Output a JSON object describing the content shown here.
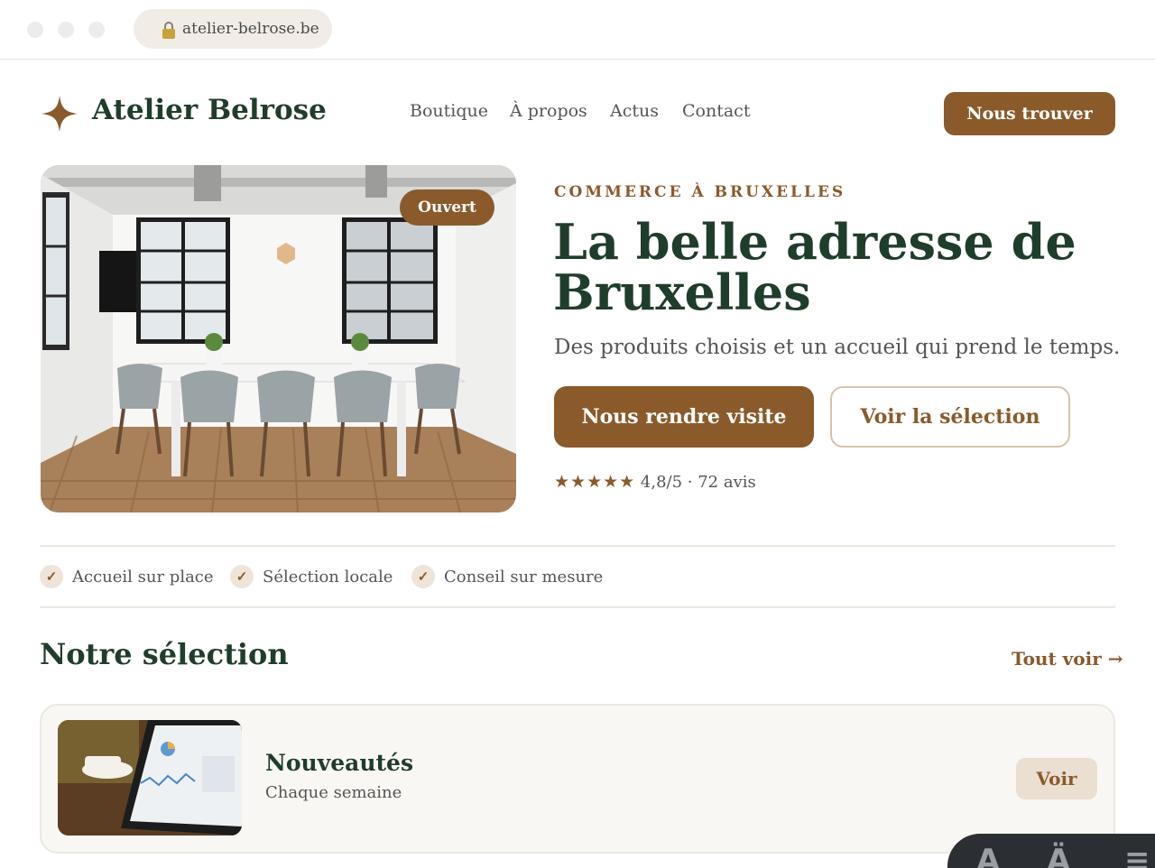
{
  "browser": {
    "url": "atelier-belrose.be"
  },
  "header": {
    "brand": "Atelier Belrose",
    "nav": [
      "Boutique",
      "À propos",
      "Actus",
      "Contact"
    ],
    "cta": "Nous trouver"
  },
  "hero": {
    "badge": "Ouvert",
    "eyebrow": "COMMERCE À BRUXELLES",
    "title": "La belle adresse de Bruxelles",
    "lead": "Des produits choisis et un accueil qui prend le temps.",
    "primary_button": "Nous rendre visite",
    "secondary_button": "Voir la sélection",
    "stars": "★★★★★",
    "rating": "4,8/5 · 72 avis"
  },
  "features": [
    "Accueil sur place",
    "Sélection locale",
    "Conseil sur mesure"
  ],
  "check_glyph": "✓",
  "selection": {
    "title": "Notre sélection",
    "see_all": "Tout voir →",
    "items": [
      {
        "title": "Nouveautés",
        "subtitle": "Chaque semaine",
        "button": "Voir"
      }
    ]
  },
  "colors": {
    "accent": "#8b5a2b",
    "primary_text": "#1f3d2b",
    "soft_bg": "#f9f7f3"
  }
}
